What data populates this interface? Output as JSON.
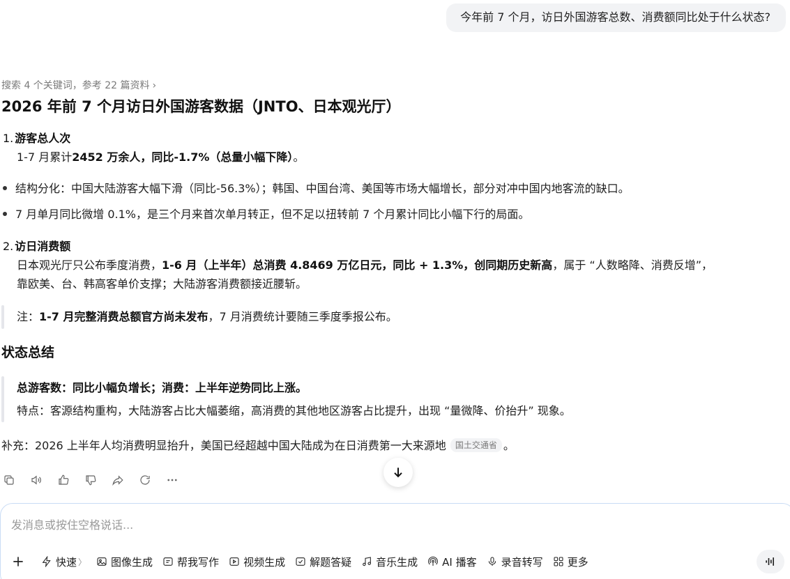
{
  "user_message": "今年前 7 个月，访日外国游客总数、消费额同比处于什么状态?",
  "answer": {
    "search_meta": "搜索 4 个关键词，参考 22 篇资料",
    "title": "2026 年前 7 个月访日外国游客数据（JNTO、日本观光厅）",
    "section1": {
      "num": "1.",
      "heading": "游客总人次",
      "line_pre": "1-7 月累计",
      "line_bold": "2452 万余人，同比-1.7%（总量小幅下降）",
      "line_post": "。"
    },
    "bullets": [
      "结构分化：中国大陆游客大幅下滑（同比-56.3%）；韩国、中国台湾、美国等市场大幅增长，部分对冲中国内地客流的缺口。",
      "7 月单月同比微增 0.1%，是三个月来首次单月转正，但不足以扭转前 7 个月累计同比小幅下行的局面。"
    ],
    "section2": {
      "num": "2.",
      "heading": "访日消费额",
      "line1_pre": "日本观光厅只公布季度消费，",
      "line1_bold": "1-6 月（上半年）总消费 4.8469 万亿日元，同比 + 1.3%，创同期历史新高",
      "line1_post": "，属于 “人数略降、消费反增”，",
      "line2": "靠欧美、台、韩高客单价支撑；大陆游客消费额接近腰斩。"
    },
    "note": {
      "pre": "注：",
      "bold": "1-7 月完整消费总额官方尚未发布",
      "post": "，7 月消费统计要随三季度季报公布。"
    },
    "summary_heading": "状态总结",
    "summary": {
      "bold": "总游客数：同比小幅负增长；消费：上半年逆势同比上涨。",
      "text": "特点：客源结构重构，大陆游客占比大幅萎缩，高消费的其他地区游客占比提升，出现 “量微降、价抬升” 现象。"
    },
    "supplement": {
      "text": "补充：2026 上半年人均消费明显抬升，美国已经超越中国大陆成为在日消费第一大来源地",
      "source": "国土交通省",
      "end": "。"
    }
  },
  "actions": [
    "copy-icon",
    "speaker-icon",
    "thumbs-up-icon",
    "thumbs-down-icon",
    "share-icon",
    "regenerate-icon",
    "more-icon"
  ],
  "composer": {
    "placeholder": "发消息或按住空格说话...",
    "tools": [
      {
        "icon": "lightning-icon",
        "label": "快速"
      },
      {
        "icon": "image-icon",
        "label": "图像生成"
      },
      {
        "icon": "write-icon",
        "label": "帮我写作"
      },
      {
        "icon": "video-icon",
        "label": "视频生成"
      },
      {
        "icon": "solve-icon",
        "label": "解题答疑"
      },
      {
        "icon": "music-icon",
        "label": "音乐生成"
      },
      {
        "icon": "podcast-icon",
        "label": "AI 播客"
      },
      {
        "icon": "mic-icon",
        "label": "录音转写"
      },
      {
        "icon": "grid-icon",
        "label": "更多"
      }
    ]
  }
}
